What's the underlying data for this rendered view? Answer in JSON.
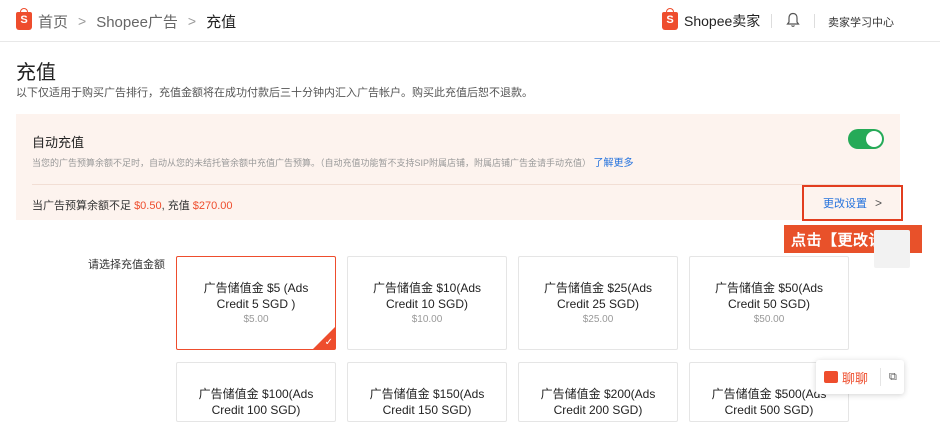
{
  "breadcrumb": {
    "home": "首页",
    "ads": "Shopee广告",
    "current": "充值",
    "separator": ">"
  },
  "header": {
    "brand": "Shopee卖家",
    "learning_center": "卖家学习中心"
  },
  "page": {
    "title": "充值",
    "description": "以下仅适用于购买广告排行，充值金额将在成功付款后三十分钟内汇入广告帐户。购买此充值后恕不退款。"
  },
  "auto_topup": {
    "title": "自动充值",
    "description": "当您的广告预算余额不足时，自动从您的未结托管余额中充值广告预算。（自动充值功能暂不支持SIP附属店铺，附属店铺广告金请手动充值）",
    "learn_more": "了解更多",
    "enabled": true,
    "condition_prefix": "当广告预算余额不足 ",
    "condition_threshold": "$0.50",
    "condition_mid": ", 充值 ",
    "condition_amount": "$270.00",
    "change_button": "更改设置",
    "chevron": ">",
    "accent_color": "#ee4d2d",
    "toggle_color": "#26aa58"
  },
  "annotation": {
    "callout": "点击【更改设置】"
  },
  "topup": {
    "choose_label": "请选择充值金额",
    "options": [
      {
        "line1": "广告储值金 $5 (Ads",
        "line2": "Credit 5 SGD )",
        "price": "$5.00",
        "selected": true
      },
      {
        "line1": "广告储值金 $10(Ads",
        "line2": "Credit 10 SGD)",
        "price": "$10.00",
        "selected": false
      },
      {
        "line1": "广告储值金 $25(Ads",
        "line2": "Credit 25 SGD)",
        "price": "$25.00",
        "selected": false
      },
      {
        "line1": "广告储值金 $50(Ads",
        "line2": "Credit 50 SGD)",
        "price": "$50.00",
        "selected": false
      },
      {
        "line1": "广告储值金 $100(Ads",
        "line2": "Credit 100 SGD)",
        "price": "",
        "selected": false
      },
      {
        "line1": "广告储值金 $150(Ads",
        "line2": "Credit 150 SGD)",
        "price": "",
        "selected": false
      },
      {
        "line1": "广告储值金 $200(Ads",
        "line2": "Credit 200 SGD)",
        "price": "",
        "selected": false
      },
      {
        "line1": "广告储值金 $500(Ads",
        "line2": "Credit 500 SGD)",
        "price": "",
        "selected": false
      }
    ]
  },
  "chat": {
    "label": "聊聊"
  },
  "icons": {
    "home": "shopee-bag-icon",
    "brand": "shopee-bag-icon",
    "notification": "bell-icon",
    "chat": "chat-icon",
    "minimize": "minimize-icon",
    "check": "check-icon"
  }
}
